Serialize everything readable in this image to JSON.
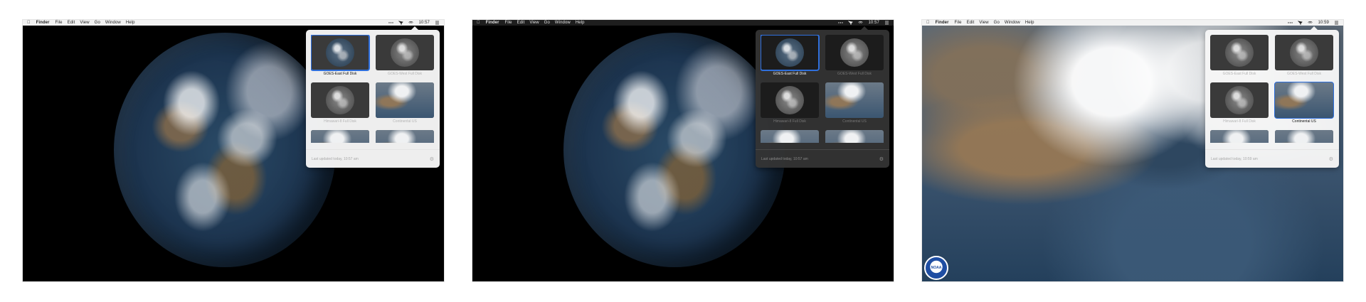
{
  "screens": [
    {
      "theme": "light",
      "menubar": {
        "app": "Finder",
        "menus": [
          "File",
          "Edit",
          "View",
          "Go",
          "Window",
          "Help"
        ],
        "time": "10:57"
      },
      "background": "earth",
      "popover": {
        "tiles": [
          {
            "label": "GOES-East Full Disk",
            "selected": true,
            "image": "disk"
          },
          {
            "label": "GOES-West Full Disk",
            "selected": false,
            "image": "disk-grey"
          },
          {
            "label": "Himawari-8 Full Disk",
            "selected": false,
            "image": "disk-grey"
          },
          {
            "label": "Continental US",
            "selected": false,
            "image": "us"
          },
          {
            "label": "",
            "selected": false,
            "image": "us"
          },
          {
            "label": "",
            "selected": false,
            "image": "us"
          }
        ],
        "footer": "Last updated today, 10:57 am"
      }
    },
    {
      "theme": "dark",
      "menubar": {
        "app": "Finder",
        "menus": [
          "File",
          "Edit",
          "View",
          "Go",
          "Window",
          "Help"
        ],
        "time": "10:57"
      },
      "background": "earth",
      "popover": {
        "tiles": [
          {
            "label": "GOES-East Full Disk",
            "selected": true,
            "image": "disk"
          },
          {
            "label": "GOES-West Full Disk",
            "selected": false,
            "image": "disk-grey"
          },
          {
            "label": "Himawari-8 Full Disk",
            "selected": false,
            "image": "disk-grey"
          },
          {
            "label": "Continental US",
            "selected": false,
            "image": "us"
          },
          {
            "label": "",
            "selected": false,
            "image": "us"
          },
          {
            "label": "",
            "selected": false,
            "image": "us"
          }
        ],
        "footer": "Last updated today, 10:57 am"
      }
    },
    {
      "theme": "light",
      "menubar": {
        "app": "Finder",
        "menus": [
          "File",
          "Edit",
          "View",
          "Go",
          "Window",
          "Help"
        ],
        "time": "10:59"
      },
      "background": "conus",
      "logo_text": "NOAA",
      "popover": {
        "tiles": [
          {
            "label": "GOES-East Full Disk",
            "selected": false,
            "image": "disk-grey"
          },
          {
            "label": "GOES-West Full Disk",
            "selected": false,
            "image": "disk-grey"
          },
          {
            "label": "Himawari-8 Full Disk",
            "selected": false,
            "image": "disk-grey"
          },
          {
            "label": "Continental US",
            "selected": true,
            "image": "us"
          },
          {
            "label": "",
            "selected": false,
            "image": "us"
          },
          {
            "label": "",
            "selected": false,
            "image": "us"
          }
        ],
        "footer": "Last updated today, 10:59 am"
      }
    }
  ],
  "icons": {
    "apple": "apple-icon",
    "more": "more-icon",
    "status_app": "satellite-icon",
    "wifi": "wifi-icon",
    "list": "list-icon",
    "gear": "gear-icon"
  },
  "colors": {
    "selection": "#2f6fdc"
  }
}
